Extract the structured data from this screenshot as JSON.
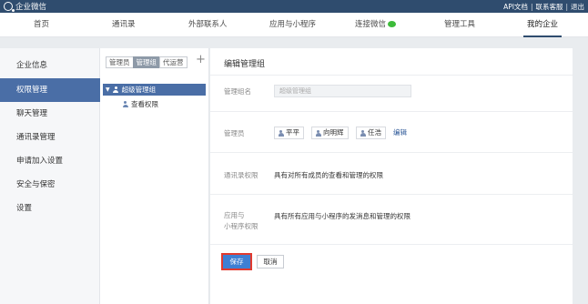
{
  "topbar": {
    "brand": "企业微信",
    "links": [
      "API文档",
      "联系客服",
      "退出"
    ]
  },
  "nav": {
    "items": [
      {
        "label": "首页"
      },
      {
        "label": "通讯录"
      },
      {
        "label": "外部联系人"
      },
      {
        "label": "应用与小程序"
      },
      {
        "label": "连接微信"
      },
      {
        "label": "管理工具"
      },
      {
        "label": "我的企业",
        "active": true
      }
    ]
  },
  "sidebar": {
    "items": [
      {
        "label": "企业信息"
      },
      {
        "label": "权限管理",
        "active": true
      },
      {
        "label": "聊天管理"
      },
      {
        "label": "通讯录管理"
      },
      {
        "label": "申请加入设置"
      },
      {
        "label": "安全与保密"
      },
      {
        "label": "设置"
      }
    ]
  },
  "tree": {
    "tabs": [
      {
        "label": "管理员"
      },
      {
        "label": "管理组",
        "active": true
      },
      {
        "label": "代运营"
      }
    ],
    "add_symbol": "+",
    "root_label": "超级管理组",
    "child_label": "查看权限"
  },
  "panel": {
    "title": "编辑管理组",
    "group_name_label": "管理组名",
    "group_name_value": "超级管理组",
    "admins_label": "管理员",
    "admins": [
      "平平",
      "向明辉",
      "任浩"
    ],
    "edit_link": "编辑",
    "contacts_perm_label": "通讯录权限",
    "contacts_perm_text": "具有对所有成员的查看和管理的权限",
    "apps_perm_label_line1": "应用与",
    "apps_perm_label_line2": "小程序权限",
    "apps_perm_text": "具有所有应用与小程序的发消息和管理的权限",
    "save_label": "保存",
    "cancel_label": "取消"
  },
  "colors": {
    "topbar": "#2f4c6e",
    "active_blue": "#4a6ea6",
    "save_button": "#3e7fd3",
    "highlight_border": "#e23a2e",
    "wechat_green": "#3dbb3a"
  }
}
